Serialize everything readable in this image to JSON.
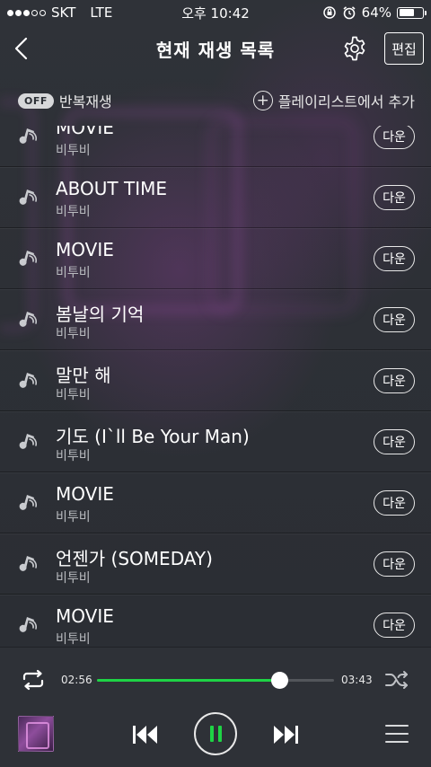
{
  "status": {
    "carrier": "SKT",
    "network": "LTE",
    "time": "오후 10:42",
    "battery": "64%",
    "battery_level": 0.64
  },
  "header": {
    "title": "현재 재생 목록",
    "edit_label": "편집"
  },
  "toolbar": {
    "repeat_state": "OFF",
    "repeat_label": "반복재생",
    "add_playlist_label": "플레이리스트에서 추가"
  },
  "songs": [
    {
      "title": "MOVIE",
      "artist": "비투비",
      "button": "다운"
    },
    {
      "title": "ABOUT TIME",
      "artist": "비투비",
      "button": "다운"
    },
    {
      "title": "MOVIE",
      "artist": "비투비",
      "button": "다운"
    },
    {
      "title": "봄날의 기억",
      "artist": "비투비",
      "button": "다운"
    },
    {
      "title": "말만 해",
      "artist": "비투비",
      "button": "다운"
    },
    {
      "title": "기도 (I`ll Be Your Man)",
      "artist": "비투비",
      "button": "다운"
    },
    {
      "title": "MOVIE",
      "artist": "비투비",
      "button": "다운"
    },
    {
      "title": "언젠가 (SOMEDAY)",
      "artist": "비투비",
      "button": "다운"
    },
    {
      "title": "MOVIE",
      "artist": "비투비",
      "button": "다운"
    }
  ],
  "player": {
    "current_time": "02:56",
    "total_time": "03:43",
    "progress": 0.77,
    "accent_color": "#1ed345"
  },
  "icons": {
    "back": "chevron-left-icon",
    "settings": "gear-icon",
    "song": "music-note-icon",
    "repeat": "repeat-icon",
    "shuffle": "shuffle-icon",
    "prev": "skip-previous-icon",
    "pause": "pause-icon",
    "next": "skip-next-icon",
    "menu": "hamburger-menu-icon"
  }
}
